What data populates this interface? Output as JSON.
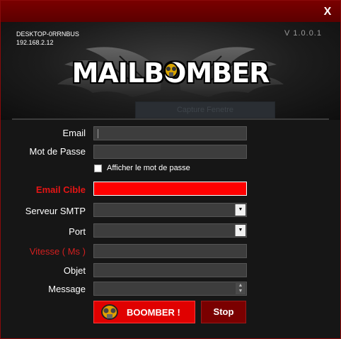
{
  "window": {
    "close_label": "X"
  },
  "header": {
    "hostname": "DESKTOP-0RRNBUS",
    "ip": "192.168.2.12",
    "version": "V 1.0.0.1",
    "logo_text": "MAILBOMBER",
    "capture_label": "Capture Fenetre"
  },
  "form": {
    "email": {
      "label": "Email",
      "value": ""
    },
    "password": {
      "label": "Mot de Passe",
      "value": ""
    },
    "show_password": {
      "label": "Afficher le mot de passe",
      "checked": false
    },
    "target_email": {
      "label": "Email Cible",
      "value": ""
    },
    "smtp_server": {
      "label": "Serveur SMTP",
      "value": ""
    },
    "port": {
      "label": "Port",
      "value": ""
    },
    "speed": {
      "label": "Vitesse ( Ms )",
      "value": ""
    },
    "subject": {
      "label": "Objet",
      "value": ""
    },
    "message": {
      "label": "Message",
      "value": ""
    }
  },
  "actions": {
    "boomber_label": "BOOMBER !",
    "stop_label": "Stop"
  },
  "colors": {
    "accent_red": "#ff0000",
    "label_red": "#e51515",
    "title_bar": "#6a0000",
    "field_bg": "#3d3d3d"
  },
  "icons": [
    "close-icon",
    "wings-logo-icon",
    "gas-mask-icon",
    "dropdown-arrow-icon",
    "spinner-arrows-icon"
  ]
}
